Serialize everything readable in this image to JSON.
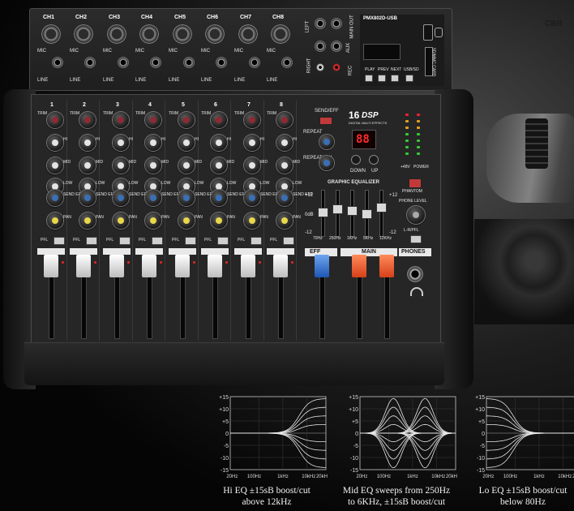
{
  "mixer": {
    "channels": [
      "CH1",
      "CH2",
      "CH3",
      "CH4",
      "CH5",
      "CH6",
      "CH7",
      "CH8"
    ],
    "strip_numbers": [
      "1",
      "2",
      "3",
      "4",
      "5",
      "6",
      "7",
      "8"
    ],
    "mic_label": "MIC",
    "line_label": "LINE",
    "trim_label": "TRIM",
    "hi_label": "HI",
    "mid_label": "MID",
    "low_label": "LOW",
    "send_label": "SEND EFF",
    "pan_label": "PAN",
    "pfl_label": "PFL",
    "model": "PMX802D-USB",
    "usb_buttons": [
      "PLAY",
      "PREV",
      "NEXT",
      "USB/SD"
    ],
    "sd_label": "SD/MMC CARD",
    "rec_labels": [
      "LEFT",
      "RIGHT",
      "MAIN OUT",
      "AUX",
      "REC"
    ],
    "send_eff_label": "SEND/EFF",
    "repeat_label": "REPEAT",
    "repeat_vol_label": "REPEAT VOL",
    "dsp_number": "16",
    "dsp_label": "DSP",
    "dsp_sub": "DIGITAL MULTI EFFECTS",
    "dsp_display": "88",
    "down_label": "DOWN",
    "up_label": "UP",
    "geq_title": "GRAPHIC EQUALIZER",
    "geq_bands": [
      "70Hz",
      "250Hz",
      "1KHz",
      "5KHz",
      "12KHz"
    ],
    "geq_scale": [
      "+12",
      "0dB",
      "-12"
    ],
    "phantom_label": "PHANTOM",
    "phones_level_label": "PHONE LEVEL",
    "lr_pfl_label": "L-R/PFL",
    "phones_label": "PHONES",
    "eff_label": "EFF",
    "main_label": "MAIN",
    "power_label": "POWER",
    "p48_label": "+48V",
    "watermark": "CBR"
  },
  "eq_graphs": [
    {
      "caption_line1": "Hi EQ ±15sB boost/cut",
      "caption_line2": "above 12kHz",
      "y_ticks": [
        "+15",
        "+10",
        "+5",
        "0",
        "-5",
        "-10",
        "-15"
      ],
      "x_ticks": [
        "20Hz",
        "100Hz",
        "1kHz",
        "10kHz",
        "20kHz"
      ]
    },
    {
      "caption_line1": "Mid EQ sweeps from 250Hz",
      "caption_line2": "to 6KHz, ±15sB boost/cut",
      "y_ticks": [
        "+15",
        "+10",
        "+5",
        "0",
        "-5",
        "-10",
        "-15"
      ],
      "x_ticks": [
        "20Hz",
        "100Hz",
        "1kHz",
        "10kHz",
        "20kHz"
      ]
    },
    {
      "caption_line1": "Lo EQ ±15sB boost/cut",
      "caption_line2": "below 80Hz",
      "y_ticks": [
        "+15",
        "+10",
        "+5",
        "0",
        "-5",
        "-10",
        "-15"
      ],
      "x_ticks": [
        "20Hz",
        "100Hz",
        "1kHz",
        "10kHz",
        "20kHz"
      ]
    }
  ],
  "colors": {
    "trim_cap": "#8d2a34",
    "hi_cap": "#e0e0e0",
    "send_cap": "#3b6fb5",
    "pan_cap": "#e7d74a",
    "channel_fader": "#e7e7e7",
    "eff_fader": "#2f6fd0",
    "main_fader": "#ef5a2a"
  }
}
